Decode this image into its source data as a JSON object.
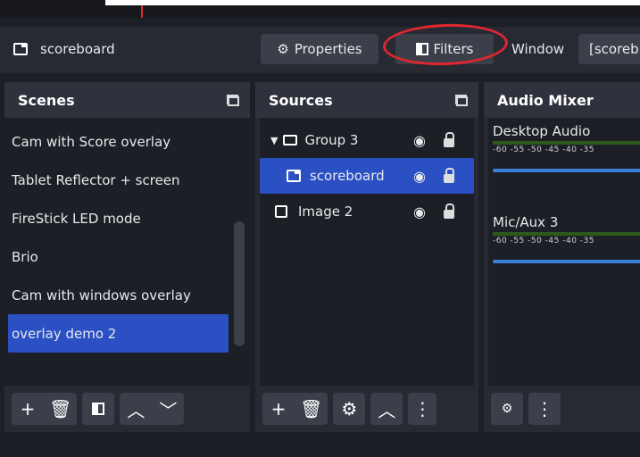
{
  "source_toolbar": {
    "current_source": "scoreboard",
    "properties_label": "Properties",
    "filters_label": "Filters",
    "window_label": "Window",
    "window_value": "[scoreb"
  },
  "scenes": {
    "title": "Scenes",
    "items": [
      {
        "label": "Cam with Score overlay"
      },
      {
        "label": "Tablet Reflector + screen"
      },
      {
        "label": "FireStick LED mode"
      },
      {
        "label": "Brio"
      },
      {
        "label": "Cam with windows overlay"
      },
      {
        "label": "overlay demo 2",
        "selected": true
      }
    ]
  },
  "sources": {
    "title": "Sources",
    "items": [
      {
        "label": "Group 3",
        "type": "group"
      },
      {
        "label": "scoreboard",
        "type": "window",
        "selected": true
      },
      {
        "label": "Image 2",
        "type": "image"
      }
    ]
  },
  "audio_mixer": {
    "title": "Audio Mixer",
    "channels": [
      {
        "name": "Desktop Audio",
        "ticks": "-60  -55  -50  -45  -40  -35"
      },
      {
        "name": "Mic/Aux 3",
        "ticks": "-60  -55  -50  -45  -40  -35"
      }
    ]
  },
  "colors": {
    "accent": "#2a50c4",
    "annotation": "#e0262e",
    "volume": "#3b82d6"
  }
}
